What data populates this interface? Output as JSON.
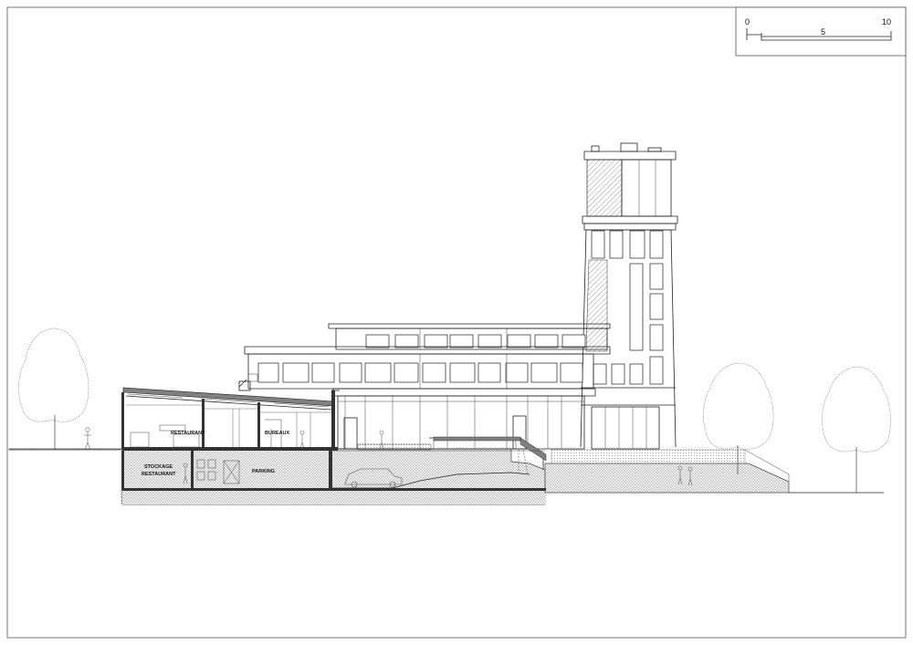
{
  "scale_bar": {
    "labels": [
      "0",
      "5",
      "10"
    ]
  },
  "rooms": {
    "restaurant": "RESTAURANT",
    "bureaux": "BUREAUX",
    "stockage_line1": "STOCKAGE",
    "stockage_line2": "RESTAURANT",
    "parking": "PARKING"
  }
}
